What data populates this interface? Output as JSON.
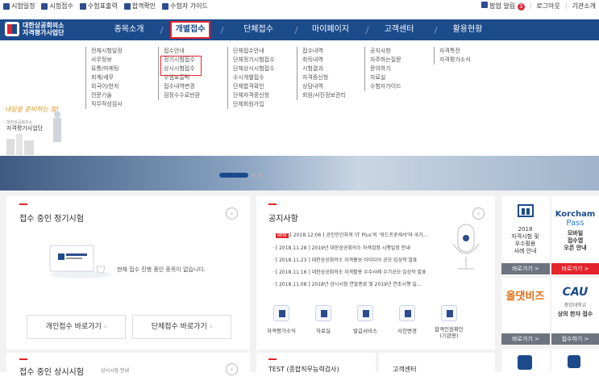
{
  "topbar": {
    "quick": [
      "시험일정",
      "시험접수",
      "수험표출력",
      "합격확인",
      "수험자 가이드"
    ],
    "popup": "팝업 알림",
    "popup_count": "3",
    "logout": "로그아웃",
    "agency": "기관소개"
  },
  "logo": {
    "line1": "대한상공회의소",
    "line2": "자격평가사업단"
  },
  "nav": [
    "종목소개",
    "개별접수",
    "단체접수",
    "마이페이지",
    "고객센터",
    "활용현황"
  ],
  "mega": {
    "col1": [
      "전체시험일정",
      "사무정보",
      "유통/마케팅",
      "회계/세무",
      "외국어/한자",
      "전문기술",
      "직무적성검사"
    ],
    "col2": [
      "접수안내",
      "정기시험접수",
      "상시시험접수",
      "수험표출력",
      "접수내역변경",
      "검정수수료반환"
    ],
    "col3": [
      "단체접수안내",
      "단체정기시험접수",
      "단체상시시험접수",
      "수시개별접수",
      "단체합격확인",
      "단체자격증신청",
      "단체회원가입"
    ],
    "col4": [
      "접수내역",
      "취득내역",
      "시험결과",
      "자격증신청",
      "상담내역",
      "회원/사진정보관리"
    ],
    "col5": [
      "공지사항",
      "자주하는질문",
      "문의하기",
      "자료실",
      "수험자가이드"
    ],
    "col6": [
      "자격특전",
      "자격평가소식"
    ]
  },
  "promo": {
    "slogan": "내일을 준비하는 힘!",
    "org1": "대한상공회의소",
    "org2": "자격평가사업단"
  },
  "cards": {
    "exam_title": "접수 중인 정기시험",
    "exam_empty": "현재 접수 진행 중인 종목이 없습니다.",
    "btn_individual": "개인접수 바로가기",
    "btn_group": "단체접수 바로가기",
    "notice_title": "공지사항",
    "notices": [
      {
        "tag": "NEW",
        "text": "[ 2018.12.06 ] 공인민간자격 'IT Plus'의 '워드프로세서'와 국가..."
      },
      {
        "tag": "",
        "text": "[ 2018.11.28 ] 2019년 대한상공회의소 자격검정 시행일정 안내"
      },
      {
        "tag": "",
        "text": "[ 2018.11.23 ] 대한상공회의소 자격홍보 아이디어 공모 입상작 발표"
      },
      {
        "tag": "",
        "text": "[ 2018.11.16 ] 대한상공회의소 자격활용 우수사례 수기공모 입상작 발표"
      },
      {
        "tag": "",
        "text": "[ 2018.11.08 ] 2018년 상시시험 연말종료 및 2019년 연초시행 일..."
      }
    ],
    "icons": [
      "자격평가소식",
      "자료실",
      "발급서비스",
      "사진변경",
      "합격인원확인\n(기관용)"
    ],
    "bottom1": "접수 중인 상시시험",
    "bottom1_sub": "상시시험 안내",
    "bottom2": "TEST (종합직무능력검사)",
    "bottom3": "고객센터"
  },
  "side": {
    "s1_year": "2018",
    "s1_l1": "자격시험 및",
    "s1_l2": "우수활용",
    "s1_l3": "사례 안내",
    "s1_btn": "바로가기 >",
    "s2_brand": "Korcham",
    "s2_pass": "Pass",
    "s2_l1": "모바일",
    "s2_l2": "접수앱",
    "s2_l3": "오픈 안내",
    "s2_btn": "바로가기 >",
    "s3_brand": "올댓비즈",
    "s3_btn": "바로가기 >",
    "s4_brand": "CAU",
    "s4_l1": "중앙대학교",
    "s4_l2": "상의 한자 접수",
    "s4_btn": "접수하기 >"
  },
  "colors": {
    "navy": "#1c4b8c",
    "red": "#e3242b",
    "gray": "#f2f2f2"
  }
}
